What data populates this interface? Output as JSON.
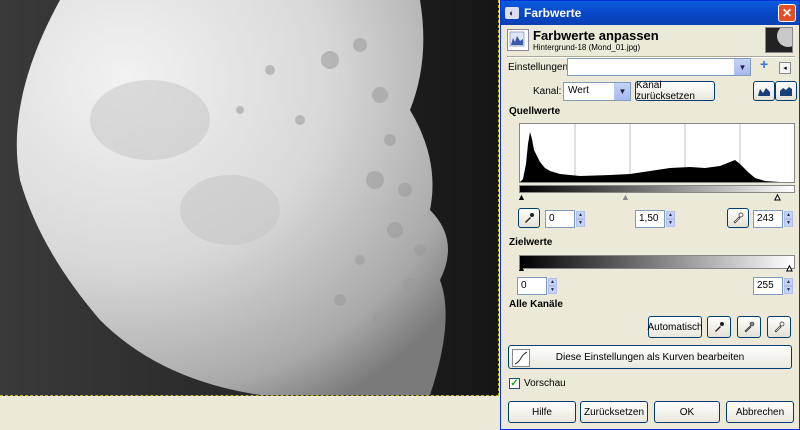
{
  "dialog": {
    "window_title": "Farbwerte",
    "close_glyph": "✕",
    "heading": "Farbwerte anpassen",
    "subheading": "Hintergrund-18 (Mond_01.jpg)"
  },
  "settings": {
    "label": "Einstellungen:",
    "value": "",
    "add_glyph": "+"
  },
  "channel": {
    "label": "Kanal:",
    "value": "Wert",
    "reset_label": "Kanal zurücksetzen"
  },
  "source": {
    "heading": "Quellwerte",
    "black": "0",
    "gamma": "1,50",
    "white": "243"
  },
  "target": {
    "heading": "Zielwerte",
    "black": "0",
    "white": "255"
  },
  "all_channels": {
    "heading": "Alle Kanäle",
    "auto_label": "Automatisch"
  },
  "curves_button": "Diese Einstellungen als Kurven bearbeiten",
  "preview": {
    "label": "Vorschau",
    "checked": true
  },
  "footer": {
    "help": "Hilfe",
    "reset": "Zurücksetzen",
    "ok": "OK",
    "cancel": "Abbrechen"
  },
  "icons": [
    "window-icon",
    "close-icon",
    "levels-icon",
    "image-thumbnail",
    "dropdown-arrow-icon",
    "add-preset-icon",
    "menu-icon",
    "linear-histogram-icon",
    "log-histogram-icon",
    "eyedropper-black-icon",
    "eyedropper-gray-icon",
    "eyedropper-white-icon",
    "curves-icon",
    "check-icon"
  ],
  "colors": {
    "titlebar": "#0a5ddf",
    "window_bg": "#ece9d8",
    "selection_border": "#c8b400"
  }
}
